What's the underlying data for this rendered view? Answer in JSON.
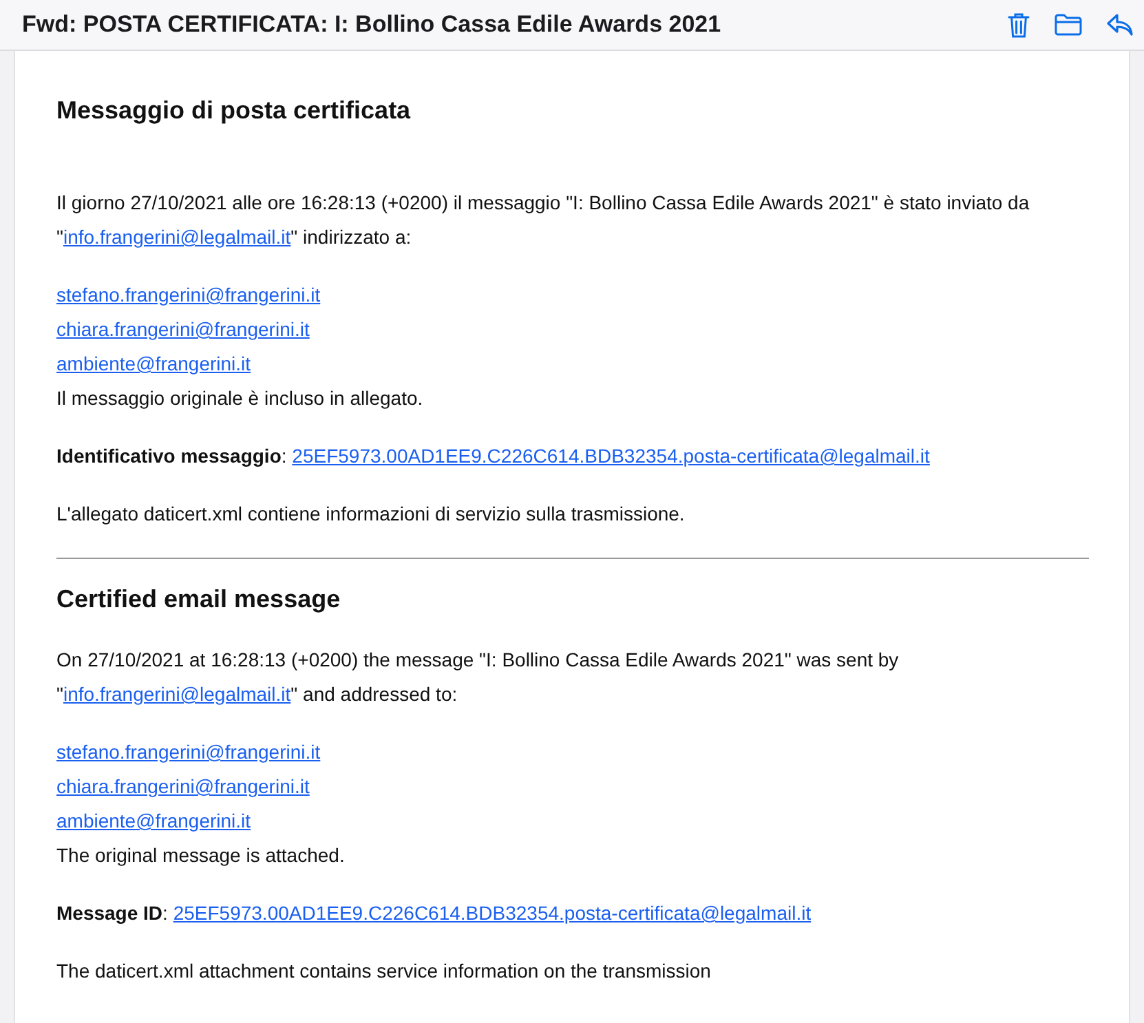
{
  "window": {
    "title": "Fwd: POSTA CERTIFICATA: I: Bollino Cassa Edile Awards 2021"
  },
  "toolbar": [
    {
      "kind": "trash"
    },
    {
      "kind": "folder"
    },
    {
      "kind": "reply"
    }
  ],
  "sections": [
    {
      "heading": "Messaggio di posta certificata",
      "intro_before": "Il giorno 27/10/2021 alle ore 16:28:13 (+0200) il messaggio \"I: Bollino Cassa Edile Awards 2021\" è stato inviato da \"",
      "sender": "info.frangerini@legalmail.it",
      "intro_after": "\" indirizzato a:",
      "recipients": [
        "stefano.frangerini@frangerini.it",
        "chiara.frangerini@frangerini.it",
        "ambiente@frangerini.it"
      ],
      "note": "Il messaggio originale è incluso in allegato.",
      "id_label": "Identificativo messaggio",
      "id_sep": ":",
      "id": "25EF5973.00AD1EE9.C226C614.BDB32354.posta-certificata@legalmail.it",
      "footer": "L'allegato daticert.xml contiene informazioni di servizio sulla trasmissione."
    },
    {
      "heading": "Certified email message",
      "intro_before": "On 27/10/2021 at 16:28:13 (+0200) the message \"I: Bollino Cassa Edile Awards 2021\" was sent by \"",
      "sender": "info.frangerini@legalmail.it",
      "intro_after": "\" and addressed to:",
      "recipients": [
        "stefano.frangerini@frangerini.it",
        "chiara.frangerini@frangerini.it",
        "ambiente@frangerini.it"
      ],
      "note": "The original message is attached.",
      "id_label": "Message ID",
      "id_sep": ":",
      "id": "25EF5973.00AD1EE9.C226C614.BDB32354.posta-certificata@legalmail.it",
      "footer": "The daticert.xml attachment contains service information on the transmission"
    }
  ]
}
